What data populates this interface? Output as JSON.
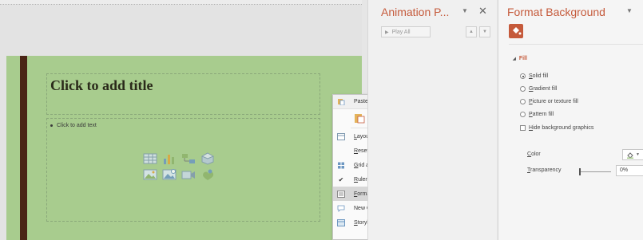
{
  "slide": {
    "title_placeholder": "Click to add title",
    "content_placeholder": "Click to add text",
    "placeholder_icons": [
      "table-icon",
      "chart-icon",
      "smartart-icon",
      "3d-model-icon",
      "picture-icon",
      "online-picture-icon",
      "video-icon",
      "icons-insert-icon"
    ],
    "colors": {
      "background": "#a8cc8e",
      "accent_bar": "#4a2516"
    }
  },
  "context_menu": {
    "paste_header": "Paste Options:",
    "items": [
      {
        "label": "Layout",
        "submenu": true
      },
      {
        "label": "Reset Slide",
        "submenu": false
      },
      {
        "label": "Grid and Guides...",
        "submenu": true
      },
      {
        "label": "Ruler",
        "submenu": false,
        "checked": true
      },
      {
        "label": "Format Background...",
        "submenu": false,
        "highlighted": true
      },
      {
        "label": "New Comment",
        "submenu": false
      },
      {
        "label": "Storyboarding",
        "submenu": true
      }
    ]
  },
  "animation_pane": {
    "title": "Animation P...",
    "play_all": "Play All"
  },
  "format_pane": {
    "title": "Format Background",
    "fill_section": "Fill",
    "options": [
      {
        "label": "Solid fill",
        "type": "radio",
        "selected": true
      },
      {
        "label": "Gradient fill",
        "type": "radio",
        "selected": false
      },
      {
        "label": "Picture or texture fill",
        "type": "radio",
        "selected": false
      },
      {
        "label": "Pattern fill",
        "type": "radio",
        "selected": false
      },
      {
        "label": "Hide background graphics",
        "type": "checkbox",
        "selected": false
      }
    ],
    "color_label": "Color",
    "transparency_label": "Transparency",
    "transparency_value": "0%",
    "accent_color": "#c55a3b"
  }
}
